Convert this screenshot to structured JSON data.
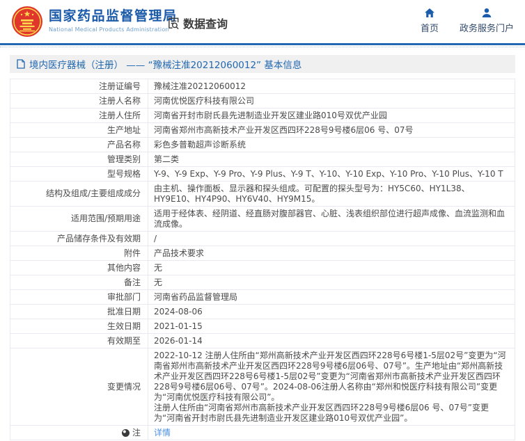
{
  "header": {
    "org_cn": "国家药品监督管理局",
    "org_en": "National Medical Products Administration",
    "data_query_label": "数据查询",
    "nav": [
      {
        "label": "首页",
        "icon": "home-icon"
      },
      {
        "label": "政务服务门户",
        "icon": "user-icon"
      }
    ]
  },
  "breadcrumb": {
    "text": "境内医疗器械（注册） —— “豫械注准20212060012” 基本信息"
  },
  "table": {
    "rows": [
      {
        "label": "注册证编号",
        "value": "豫械注准20212060012"
      },
      {
        "label": "注册人名称",
        "value": "河南优悦医疗科技有限公司"
      },
      {
        "label": "注册人住所",
        "value": "河南省开封市尉氏县先进制造业开发区建业路010号双优产业园"
      },
      {
        "label": "生产地址",
        "value": "河南省郑州市高新技术产业开发区西四环228号9号楼6层06 号、07号"
      },
      {
        "label": "产品名称",
        "value": "彩色多普勒超声诊断系统"
      },
      {
        "label": "管理类别",
        "value": "第二类"
      },
      {
        "label": "型号规格",
        "value": "Y-9、Y-9 Exp、Y-9 Pro、Y-9 Plus、Y-9 T、Y-10、Y-10 Exp、Y-10 Pro、Y-10 Plus、Y-10 T"
      },
      {
        "label": "结构及组成/主要组成成分",
        "value": "由主机、操作面板、显示器和探头组成。可配置的探头型号为：HY5C60、HY1L38、HY9E10、HY4P90、HY6V40、HY9M15。"
      },
      {
        "label": "适用范围/预期用途",
        "value": "适用于经体表、经阴道、经直肠对腹部器官、心脏、浅表组织部位进行超声成像、血流监测和血流成像。"
      },
      {
        "label": "产品储存条件及有效期",
        "value": "/"
      },
      {
        "label": "附件",
        "value": "产品技术要求"
      },
      {
        "label": "其他内容",
        "value": "无"
      },
      {
        "label": "备注",
        "value": "无"
      },
      {
        "label": "审批部门",
        "value": "河南省药品监督管理局"
      },
      {
        "label": "批准日期",
        "value": "2024-08-06"
      },
      {
        "label": "生效日期",
        "value": "2021-01-15"
      },
      {
        "label": "有效期至",
        "value": "2026-01-14"
      },
      {
        "label": "变更情况",
        "value": "2022-10-12 注册人住所由“郑州高新技术产业开发区西四环228号6号楼1-5层02号”变更为“河南省郑州市高新技术产业开发区西四环228号9号楼6层06号、07号”。生产地址由“郑州高新技术产业开发区西四环228号6号楼1-5层02号”变更为“河南省郑州市高新技术产业开发区西四环228号9号楼6层06号、07号”。2024-08-06注册人名称由“郑州和悦医疗科技有限公司”变更为“河南优悦医疗科技有限公司”。\n注册人住所由“河南省郑州市高新技术产业开发区西四环228号9号楼6层06 号、07号”变更为“河南省开封市尉氏县先进制造业开发区建业路010号双优产业园”。"
      },
      {
        "label": "注",
        "label_icon": "note-icon",
        "value": "详情",
        "link": true
      }
    ]
  },
  "colors": {
    "accent_blue": "#1a5aa8",
    "rule_blue": "#2268b0",
    "link_blue": "#4a90e2",
    "crumb_bg": "#f0f0f1",
    "table_border": "#e9e9f0",
    "logo_red": "#e0372c",
    "logo_gold": "#ffd94d",
    "body_text": "#4a4a4a"
  }
}
